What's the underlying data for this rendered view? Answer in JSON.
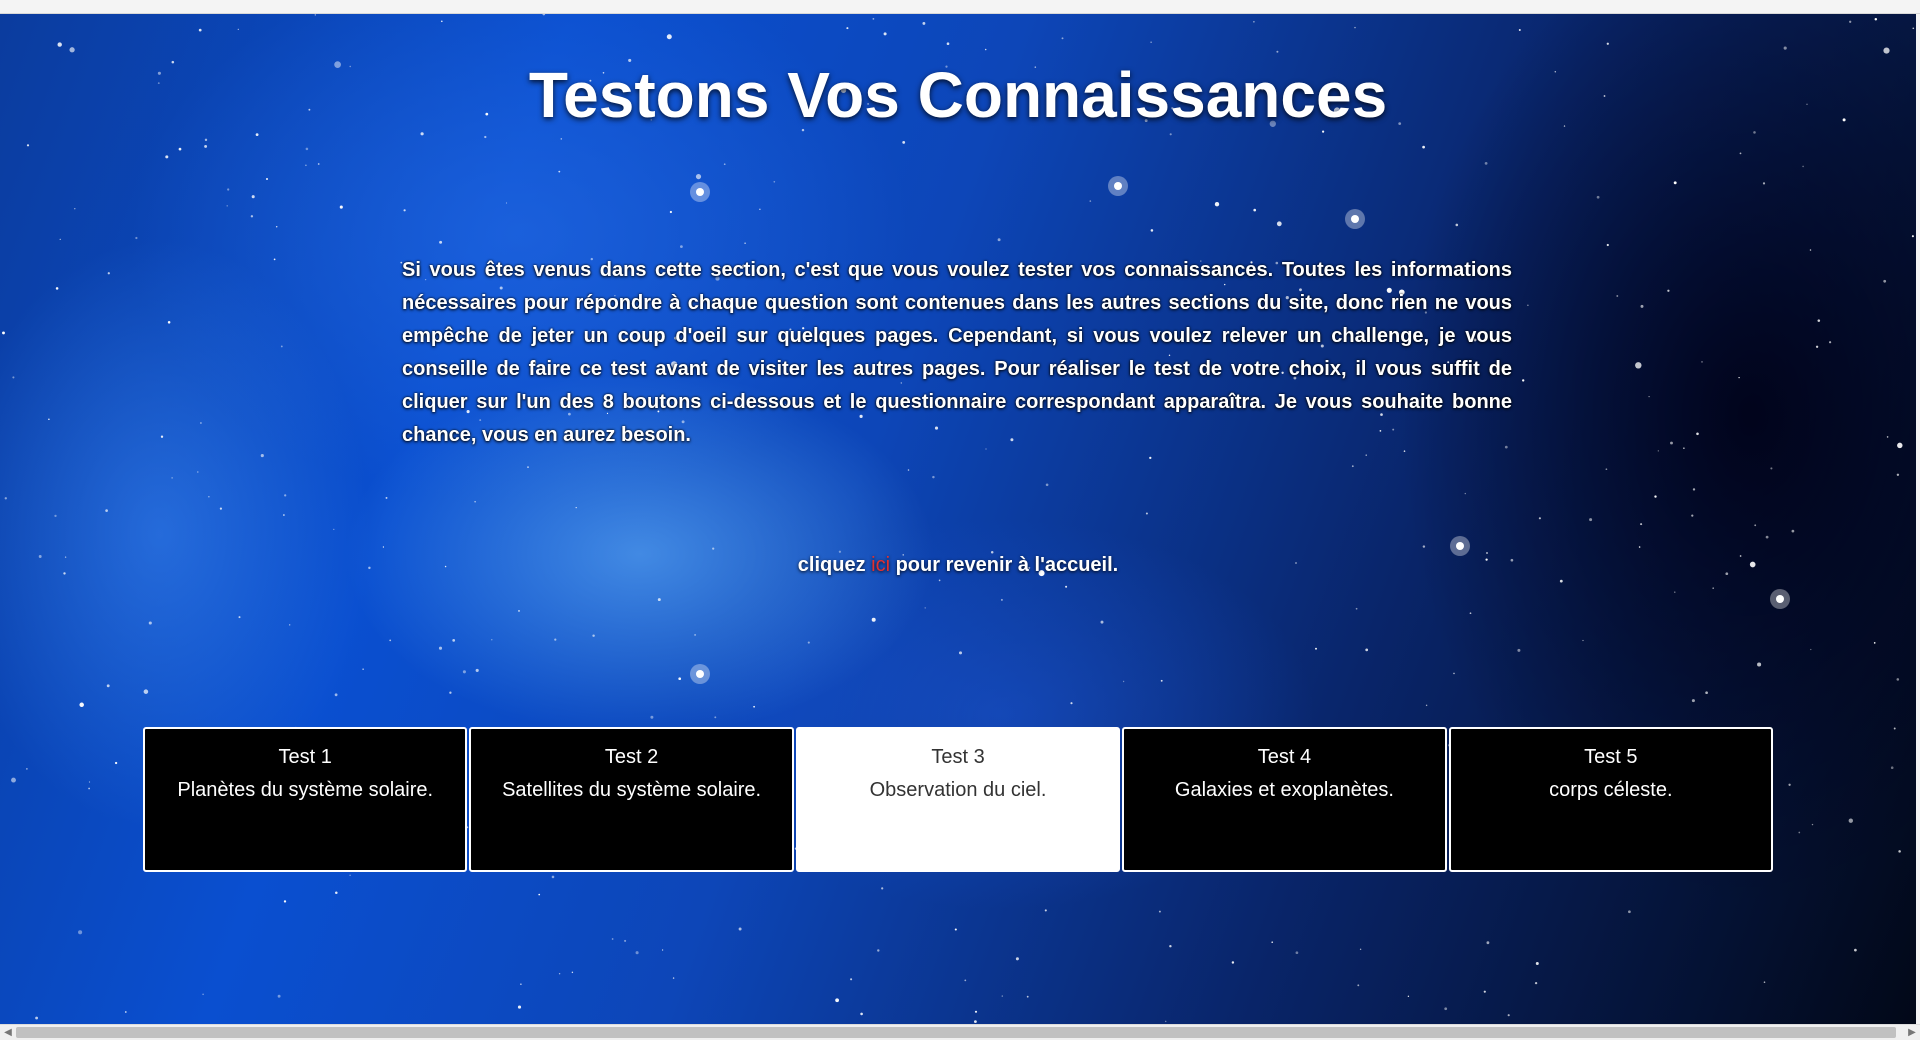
{
  "page": {
    "title": "Testons Vos Connaissances",
    "intro": "Si vous êtes venus dans cette section, c'est que vous voulez tester vos connaissances. Toutes les informations nécessaires pour répondre à chaque question sont contenues dans les autres sections du site, donc rien ne vous empêche de jeter un coup d'oeil sur quelques pages. Cependant, si vous voulez relever un challenge, je vous conseille de faire ce test avant de visiter les autres pages. Pour réaliser le test de votre choix, il vous suffit de cliquer sur l'un des 8 boutons ci-dessous et le questionnaire correspondant apparaîtra. Je vous souhaite bonne chance, vous en aurez besoin.",
    "home_prefix": "cliquez ",
    "home_link": "ici",
    "home_suffix": " pour revenir à l'accueil."
  },
  "tests": [
    {
      "label": "Test 1",
      "subtitle": "Planètes du système solaire."
    },
    {
      "label": "Test 2",
      "subtitle": "Satellites du système solaire."
    },
    {
      "label": "Test 3",
      "subtitle": "Observation du ciel."
    },
    {
      "label": "Test 4",
      "subtitle": "Galaxies et exoplanètes."
    },
    {
      "label": "Test 5",
      "subtitle": "corps céleste."
    }
  ],
  "active_test": "Test 3",
  "colors": {
    "link": "#e03030",
    "button_bg": "#000000",
    "button_active_bg": "#ffffff",
    "text": "#ffffff"
  },
  "icons": {
    "scroll_left": "chevron-left-icon",
    "scroll_right": "chevron-right-icon"
  }
}
